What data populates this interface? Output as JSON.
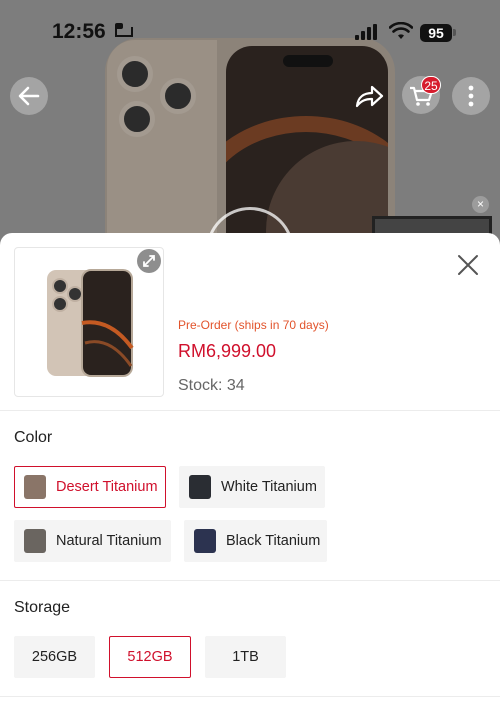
{
  "status_bar": {
    "time": "12:56",
    "battery": "95"
  },
  "header": {
    "cart_count": "25"
  },
  "product": {
    "preorder_text": "Pre-Order (ships in 70 days)",
    "price": "RM6,999.00",
    "stock": "Stock: 34"
  },
  "color_section": {
    "title": "Color",
    "options": [
      {
        "label": "Desert Titanium",
        "selected": true,
        "swatch": "#b49a86"
      },
      {
        "label": "White Titanium",
        "selected": false,
        "swatch": "#dcdcdc"
      },
      {
        "label": "Natural Titanium",
        "selected": false,
        "swatch": "#a8a39b"
      },
      {
        "label": "Black Titanium",
        "selected": false,
        "swatch": "#3d3d45"
      }
    ]
  },
  "storage_section": {
    "title": "Storage",
    "options": [
      {
        "label": "256GB",
        "selected": false
      },
      {
        "label": "512GB",
        "selected": true
      },
      {
        "label": "1TB",
        "selected": false
      }
    ]
  },
  "colors": {
    "accent": "#d0102c",
    "preorder": "#e2542c",
    "badge": "#d61c2d"
  }
}
